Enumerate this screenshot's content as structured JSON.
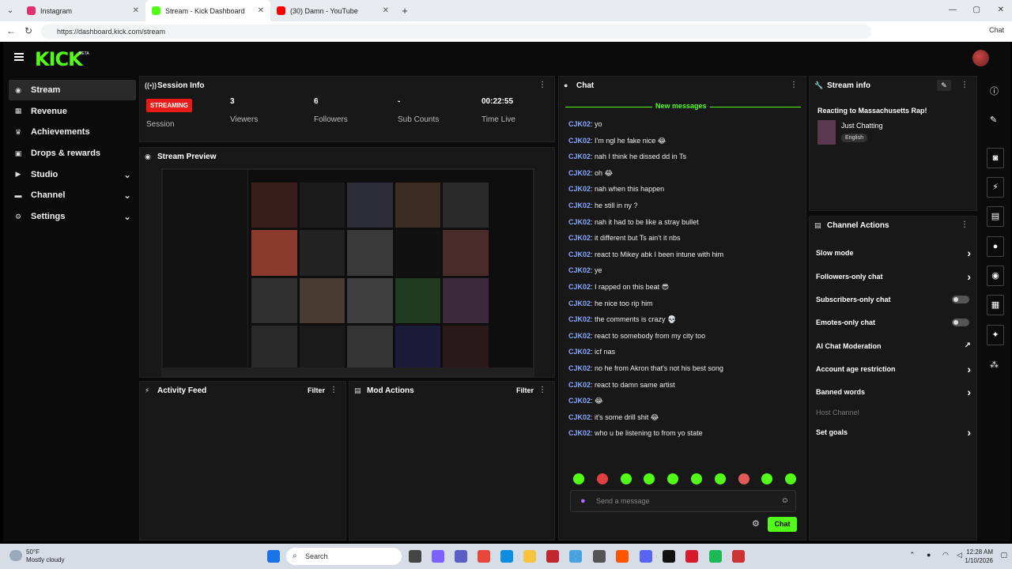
{
  "browser": {
    "tabs": [
      {
        "label": "Instagram",
        "color": "#e1306c"
      },
      {
        "label": "Stream - Kick Dashboard",
        "color": "#53fc18"
      },
      {
        "label": "(30) Damn - YouTube",
        "color": "#ff0000"
      }
    ],
    "url": "https://dashboard.kick.com/stream",
    "chat_button": "Chat"
  },
  "app": {
    "logo": "KICK",
    "logo_badge": "BETA",
    "sidebar": [
      {
        "label": "Stream",
        "icon": "stream-icon"
      },
      {
        "label": "Revenue",
        "icon": "revenue-icon"
      },
      {
        "label": "Achievements",
        "icon": "trophy-icon"
      },
      {
        "label": "Drops & rewards",
        "icon": "gift-icon"
      },
      {
        "label": "Studio",
        "icon": "video-icon"
      },
      {
        "label": "Channel",
        "icon": "channel-icon"
      },
      {
        "label": "Settings",
        "icon": "gear-icon"
      }
    ]
  },
  "session": {
    "title": "Session Info",
    "status": "STREAMING",
    "status_label": "Session",
    "viewers": {
      "value": "3",
      "label": "Viewers"
    },
    "followers": {
      "value": "6",
      "label": "Followers"
    },
    "sub_counts": {
      "value": "-",
      "label": "Sub Counts"
    },
    "time_live": {
      "value": "00:22:55",
      "label": "Time Live"
    }
  },
  "stream_preview": {
    "title": "Stream Preview"
  },
  "activity_feed": {
    "title": "Activity Feed",
    "filter": "Filter"
  },
  "mod_actions": {
    "title": "Mod Actions",
    "filter": "Filter"
  },
  "chat": {
    "title": "Chat",
    "new_messages": "New messages",
    "messages": [
      {
        "user": "CJK02",
        "text": "yo"
      },
      {
        "user": "CJK02",
        "text": "I'm ngl he fake nice 😂"
      },
      {
        "user": "CJK02",
        "text": "nah I think he dissed dd in Ts"
      },
      {
        "user": "CJK02",
        "text": "oh 😂"
      },
      {
        "user": "CJK02",
        "text": "nah when this happen"
      },
      {
        "user": "CJK02",
        "text": "he still in ny ?"
      },
      {
        "user": "CJK02",
        "text": "nah it had to be like a stray bullet"
      },
      {
        "user": "CJK02",
        "text": "it different but Ts ain't it nbs"
      },
      {
        "user": "CJK02",
        "text": "react to Mikey abk I been intune with him"
      },
      {
        "user": "CJK02",
        "text": "ye"
      },
      {
        "user": "CJK02",
        "text": "I rapped on this beat 😎"
      },
      {
        "user": "CJK02",
        "text": "he nice too rip him"
      },
      {
        "user": "CJK02",
        "text": "the comments is crazy 💀"
      },
      {
        "user": "CJK02",
        "text": "react to somebody from my city too"
      },
      {
        "user": "CJK02",
        "text": "icf nas"
      },
      {
        "user": "CJK02",
        "text": "no he from Akron that's not his best song"
      },
      {
        "user": "CJK02",
        "text": "react to damn same artist"
      },
      {
        "user": "CJK02",
        "text": "😂"
      },
      {
        "user": "CJK02",
        "text": "it's some drill shit 😂"
      },
      {
        "user": "CJK02",
        "text": "who u be listening to from yo state"
      }
    ],
    "placeholder": "Send a message",
    "send_label": "Chat"
  },
  "stream_info": {
    "title": "Stream info",
    "stream_title": "Reacting to Massachusetts Rap!",
    "category": "Just Chatting",
    "language": "English"
  },
  "channel_actions": {
    "title": "Channel Actions",
    "items": [
      {
        "label": "Slow mode",
        "control": "chevron"
      },
      {
        "label": "Followers-only chat",
        "control": "chevron"
      },
      {
        "label": "Subscribers-only chat",
        "control": "toggle"
      },
      {
        "label": "Emotes-only chat",
        "control": "toggle"
      },
      {
        "label": "AI Chat Moderation",
        "control": "external"
      },
      {
        "label": "Account age restriction",
        "control": "chevron"
      },
      {
        "label": "Banned words",
        "control": "chevron"
      },
      {
        "label": "Host Channel",
        "control": "none"
      },
      {
        "label": "Set goals",
        "control": "chevron"
      }
    ]
  },
  "taskbar": {
    "weather_temp": "50°F",
    "weather_desc": "Mostly cloudy",
    "search": "Search",
    "time": "12:28 AM",
    "date": "1/10/2026"
  }
}
